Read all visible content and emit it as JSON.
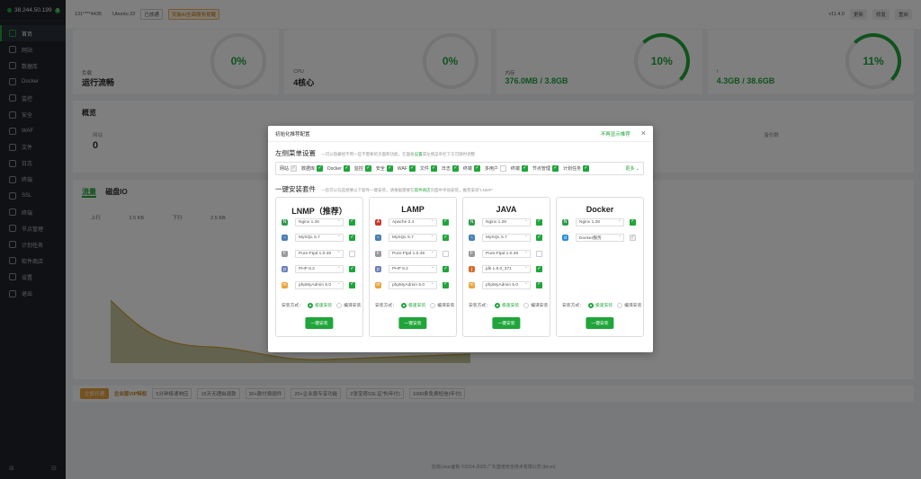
{
  "sidebar": {
    "ip": "38.244.50.199",
    "badge": "0",
    "items": [
      "首页",
      "网站",
      "数据库",
      "Docker",
      "监控",
      "安全",
      "WAF",
      "文件",
      "日志",
      "终端",
      "SSL",
      "终端",
      "节点管理",
      "计划任务",
      "软件商店",
      "设置",
      "退出"
    ]
  },
  "topbar": {
    "user": "131****4435",
    "os": "Ubuntu 22",
    "pill": "已放通",
    "warn": "安装AI全面服务提醒",
    "version": "v11.4.0",
    "update": "更新",
    "repair": "修复",
    "restart": "重启"
  },
  "cards": [
    {
      "label": "负载",
      "value": "运行流畅",
      "gauge": "0%"
    },
    {
      "label": "CPU",
      "value": "4核心",
      "gauge": "0%"
    },
    {
      "label": "内存",
      "value": "376.0MB / 3.8GB",
      "gauge": "10%"
    },
    {
      "label": "/",
      "value": "4.3GB / 38.6GB",
      "gauge": "11%"
    }
  ],
  "overview": {
    "title": "概览",
    "site_label": "网站",
    "site_count": "0",
    "backup": "备份数"
  },
  "traffic": {
    "tab1": "流量",
    "tab2": "磁盘IO",
    "up": "上行",
    "up_val": "2.5 KB",
    "down": "下行",
    "down_val": "2.5 KB"
  },
  "vip": {
    "open": "立即开通",
    "title": "企业版VIP特权",
    "tags": [
      "5分钟极速响应",
      "15天无理由退款",
      "30+款付费插件",
      "20+企业版专享功能",
      "2张宝塔SSL证书(年付)",
      "1000条免费短信(年付)"
    ]
  },
  "footer": "宝塔Linux面板 ©2014-2025 广东堡塔安全技术有限公司 (bt.cn)",
  "modal": {
    "title": "初始化推荐配置",
    "no_more": "不再显示推荐",
    "close": "×",
    "menu_title": "左侧菜单设置",
    "menu_hint": "一可以隐藏经不用一些不需要的页面和功能，在面板",
    "menu_hint_link": "设置",
    "menu_hint_tail": "或左侧菜单栏下方可随时调整",
    "menu_items": [
      {
        "label": "网站",
        "state": "dis"
      },
      {
        "label": "数据库",
        "state": "on"
      },
      {
        "label": "Docker",
        "state": "on"
      },
      {
        "label": "监控",
        "state": "on"
      },
      {
        "label": "安全",
        "state": "on"
      },
      {
        "label": "WAF",
        "state": "on"
      },
      {
        "label": "文件",
        "state": "on"
      },
      {
        "label": "日志",
        "state": "on"
      },
      {
        "label": "终端",
        "state": "on"
      },
      {
        "label": "多用户",
        "state": "off"
      },
      {
        "label": "终端",
        "state": "on"
      },
      {
        "label": "节点管理",
        "state": "on"
      },
      {
        "label": "计划任务",
        "state": "on"
      }
    ],
    "more": "更多",
    "pkg_title": "一键安装套件",
    "pkg_hint": "一您可以勾选想要以下套件一键安装，请根据需要在",
    "pkg_hint_link": "软件商店",
    "pkg_hint_tail": "页面中手动安装，推荐安装“LNMP”",
    "method_label": "安装方式：",
    "fast": "极速安装",
    "compile": "编译安装",
    "install_btn": "一键安装",
    "stacks": [
      {
        "name": "LNMP（推荐）",
        "rows": [
          {
            "icon": "N",
            "color": "#2e9a4a",
            "value": "Nginx 1.26",
            "state": "on"
          },
          {
            "icon": "~",
            "color": "#4a7fb5",
            "value": "MySQL 5.7",
            "state": "on"
          },
          {
            "icon": "F",
            "color": "#999999",
            "value": "Pure-Ftpd 1.0.49",
            "state": "off"
          },
          {
            "icon": "p",
            "color": "#6a7fb8",
            "value": "PHP 8.2",
            "state": "on"
          },
          {
            "icon": "m",
            "color": "#e8a33c",
            "value": "phpMyAdmin 5.0",
            "state": "on"
          }
        ]
      },
      {
        "name": "LAMP",
        "rows": [
          {
            "icon": "A",
            "color": "#c8352c",
            "value": "Apache 2.4",
            "state": "on"
          },
          {
            "icon": "~",
            "color": "#4a7fb5",
            "value": "MySQL 5.7",
            "state": "on"
          },
          {
            "icon": "F",
            "color": "#999999",
            "value": "Pure-Ftpd 1.0.49",
            "state": "off"
          },
          {
            "icon": "p",
            "color": "#6a7fb8",
            "value": "PHP 8.2",
            "state": "on"
          },
          {
            "icon": "m",
            "color": "#e8a33c",
            "value": "phpMyAdmin 5.0",
            "state": "on"
          }
        ]
      },
      {
        "name": "JAVA",
        "rows": [
          {
            "icon": "N",
            "color": "#2e9a4a",
            "value": "Nginx 1.28",
            "state": "on"
          },
          {
            "icon": "~",
            "color": "#4a7fb5",
            "value": "MySQL 5.7",
            "state": "on"
          },
          {
            "icon": "F",
            "color": "#999999",
            "value": "Pure-Ftpd 1.0.49",
            "state": "off"
          },
          {
            "icon": "j",
            "color": "#d86b2c",
            "value": "jdk 1.8.0_371",
            "state": "on"
          },
          {
            "icon": "m",
            "color": "#e8a33c",
            "value": "phpMyAdmin 5.0",
            "state": "on"
          }
        ]
      },
      {
        "name": "Docker",
        "rows": [
          {
            "icon": "N",
            "color": "#2e9a4a",
            "value": "Nginx 1.28",
            "state": "on"
          },
          {
            "icon": "d",
            "color": "#2a8fd6",
            "value": "Docker服务",
            "state": "dis"
          }
        ]
      }
    ]
  }
}
